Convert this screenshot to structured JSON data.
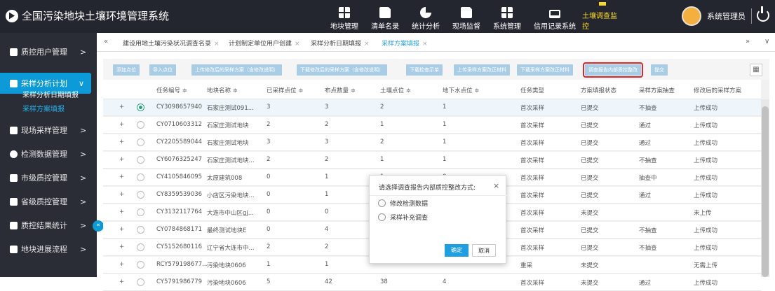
{
  "app": {
    "title": "全国污染地块土壤环境管理系统"
  },
  "topnav": [
    {
      "label": "地块管理",
      "icon": "blocks-icon"
    },
    {
      "label": "清单名录",
      "icon": "document-icon"
    },
    {
      "label": "统计分析",
      "icon": "pie-chart-icon"
    },
    {
      "label": "现场监督",
      "icon": "edit-icon"
    },
    {
      "label": "系统管理",
      "icon": "system-icon"
    },
    {
      "label": "信用记录系统",
      "icon": "monitor-icon"
    },
    {
      "label": "土壤调查监控",
      "icon": "survey-icon"
    }
  ],
  "user": {
    "name": "系统管理员"
  },
  "sidebar": {
    "items": [
      {
        "label": "质控用户管理",
        "chev": ">"
      },
      {
        "label": "采样分析计划",
        "chev": "∨"
      },
      {
        "label": "现场采样管理",
        "chev": ">"
      },
      {
        "label": "检测数据管理",
        "chev": ">"
      },
      {
        "label": "市级质控管理",
        "chev": ">"
      },
      {
        "label": "省级质控管理",
        "chev": ">"
      },
      {
        "label": "质控结果统计",
        "chev": ">"
      },
      {
        "label": "地块进展流程",
        "chev": ">"
      }
    ],
    "subitems": [
      {
        "label": "采样分析日期填报"
      },
      {
        "label": "采样方案填报"
      }
    ],
    "collapse": "«"
  },
  "tabs": {
    "left_arrow": "«",
    "right_arrow": "»",
    "more": "∨",
    "items": [
      {
        "label": "建设用地土壤污染状况调查名录"
      },
      {
        "label": "计划制定单位用户创建"
      },
      {
        "label": "采样分析日期填报"
      },
      {
        "label": "采样方案填报"
      }
    ],
    "close": "×"
  },
  "toolbar": {
    "buttons": [
      "添加点位",
      "导入点位",
      "上传修改后的采样方案（含修改说明）",
      "下载修改后的采样方案（含修改说明）",
      "下载检查示单",
      "上传采样方案改正材料",
      "下载采样方案改正材料",
      "调查报告内部质控整改",
      "提交"
    ],
    "print_icon": "▦"
  },
  "table": {
    "columns": [
      "任务编号 ≑",
      "地块名称 ≑",
      "已采样点位 ≑",
      "布点数量 ≑",
      "土壤点位 ≑",
      "地下水点位 ≑",
      "任务类型",
      "方案填报状态",
      "采样方案抽查",
      "修改后的采样方案"
    ],
    "rows": [
      [
        "CY3098657940",
        "石家庄测试091...",
        "3",
        "3",
        "2",
        "1",
        "首次采样",
        "已提交",
        "不抽查",
        "上传成功"
      ],
      [
        "CY0710603312",
        "石家庄测试地块",
        "2",
        "2",
        "1",
        "1",
        "首次采样",
        "已提交",
        "通过",
        "上传成功"
      ],
      [
        "CY2205589044",
        "石家庄测试地块",
        "3",
        "3",
        "2",
        "1",
        "首次采样",
        "已提交",
        "通过",
        "上传成功"
      ],
      [
        "CY6076325247",
        "石家庄测试地块...",
        "2",
        "2",
        "1",
        "1",
        "首次采样",
        "已提交",
        "不抽查",
        "上传成功"
      ],
      [
        "CY4105846095",
        "太原建筑008",
        "0",
        "1",
        "1",
        "0",
        "首次采样",
        "已提交",
        "抽查中",
        "上传成功"
      ],
      [
        "CY8359539036",
        "小店区污染地块...",
        "0",
        "1",
        "",
        "",
        "首次采样",
        "已提交",
        "通过",
        "上传成功"
      ],
      [
        "CY3132117764",
        "大连市中山区gj...",
        "0",
        "0",
        "",
        "",
        "首次采样",
        "未提交",
        "",
        "未上传"
      ],
      [
        "CY0784868171",
        "最终测试地块E",
        "0",
        "4",
        "",
        "",
        "首次采样",
        "已提交",
        "不抽查",
        "上传成功"
      ],
      [
        "CY5152680116",
        "辽宁省大连市中...",
        "2",
        "2",
        "",
        "",
        "首次采样",
        "已提交",
        "不抽查",
        "上传成功"
      ],
      [
        "RCY579198677...",
        "污染地块0606",
        "1",
        "1",
        "",
        "",
        "重采",
        "未提交",
        "",
        "无需上传"
      ],
      [
        "CY5791986779",
        "污染地块0606",
        "5",
        "42",
        "38",
        "4",
        "首次采样",
        "未提交",
        "通过",
        "上传成功"
      ]
    ],
    "expand": "+"
  },
  "modal": {
    "title": "请选择调查报告内部质控整改方式:",
    "close": "×",
    "options": [
      "修改检测数据",
      "采样补充调查"
    ],
    "ok": "确定",
    "cancel": "取消"
  }
}
